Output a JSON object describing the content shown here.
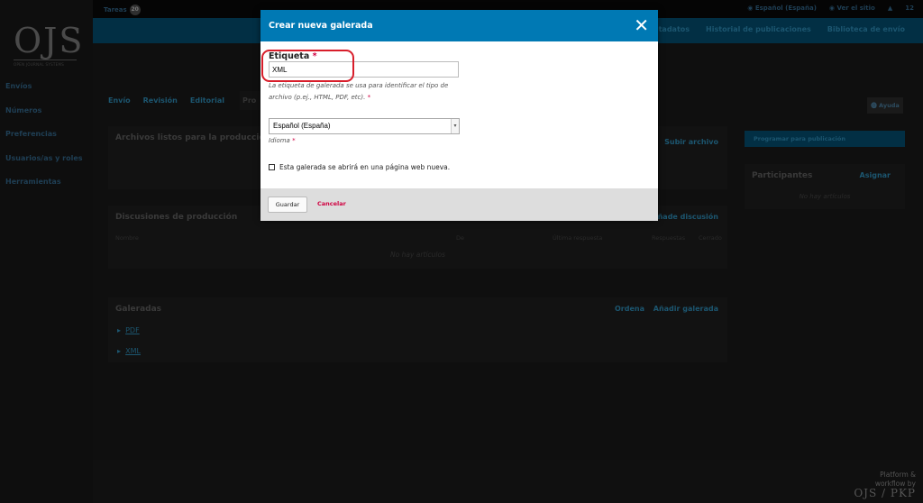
{
  "topbar": {
    "tasks_label": "Tareas",
    "tasks_count": "20",
    "language": "Español (España)",
    "view_site": "Ver el sitio",
    "user": "",
    "extra": "12"
  },
  "logo": {
    "text": "OJS",
    "subtitle": "OPEN JOURNAL SYSTEMS"
  },
  "sidebar": {
    "items": [
      {
        "label": "Envíos"
      },
      {
        "label": "Números"
      },
      {
        "label": "Preferencias"
      },
      {
        "label": "Usuarios/as y roles"
      },
      {
        "label": "Herramientas"
      }
    ]
  },
  "header": {
    "links": [
      {
        "label": "Metadatos"
      },
      {
        "label": "Historial de publicaciones"
      },
      {
        "label": "Biblioteca de envío"
      }
    ]
  },
  "tabs": [
    {
      "label": "Envío"
    },
    {
      "label": "Revisión"
    },
    {
      "label": "Editorial"
    },
    {
      "label": "Pro"
    }
  ],
  "help_label": "Ayuda",
  "files_panel": {
    "title": "Archivos listos para la producción",
    "action": "Subir archivo"
  },
  "discussions_panel": {
    "title": "Discusiones de producción",
    "action": "Añade discusión",
    "columns": [
      "Nombre",
      "De",
      "Última respuesta",
      "Respuestas",
      "Cerrado"
    ],
    "empty": "No hay artículos"
  },
  "galleys_panel": {
    "title": "Galeradas",
    "order": "Ordena",
    "add": "Añadir galerada",
    "items": [
      {
        "label": "PDF"
      },
      {
        "label": "XML"
      }
    ]
  },
  "schedule_button": "Programar para publicación",
  "participants": {
    "title": "Participantes",
    "action": "Asignar",
    "empty": "No hay artículos"
  },
  "footer": {
    "line1": "Platform &",
    "line2": "workflow by",
    "logo": "OJS / PKP"
  },
  "modal": {
    "title": "Crear nueva galerada",
    "label_field": "Etiqueta",
    "label_value": "XML",
    "label_help": "La etiqueta de galerada se usa para identificar el tipo de archivo (p.ej., HTML, PDF, etc).",
    "language_value": "Español (España)",
    "language_label": "Idioma",
    "new_page_label": "Esta galerada se abrirá en una página web nueva.",
    "save": "Guardar",
    "cancel": "Cancelar"
  },
  "colors": {
    "modal_header": "#0079b4",
    "required": "#d00040",
    "highlight_ring": "#d81e2b"
  }
}
